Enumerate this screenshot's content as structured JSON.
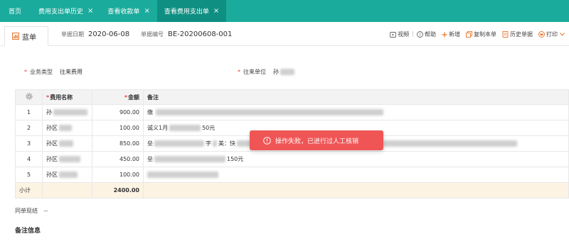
{
  "tabs": [
    {
      "label": "首页",
      "closable": false,
      "active": false
    },
    {
      "label": "费用支出单历史",
      "closable": true,
      "active": false
    },
    {
      "label": "查看收款单",
      "closable": true,
      "active": false
    },
    {
      "label": "查看费用支出单",
      "closable": true,
      "active": true
    }
  ],
  "doc": {
    "tab_label": "蓝单",
    "date_label": "单据日期",
    "date_value": "2020-06-08",
    "number_label": "单据编号",
    "number_value": "BE-20200608-001"
  },
  "toolbar": {
    "items": [
      {
        "label": "视频",
        "icon": "video-icon"
      },
      {
        "label": "帮助",
        "icon": "help-icon"
      },
      {
        "label": "新增",
        "icon": "plus-icon"
      },
      {
        "label": "复制本单",
        "icon": "copy-icon"
      },
      {
        "label": "历史单据",
        "icon": "history-icon"
      },
      {
        "label": "打印",
        "icon": "print-icon"
      }
    ],
    "separator": "|"
  },
  "form": {
    "biz_type_label": "业务类型",
    "biz_type_value": "往来费用",
    "unit_label": "往来单位",
    "unit_value": "孙"
  },
  "table": {
    "headers": {
      "settings": "settings-icon",
      "name": "费用名称",
      "amount": "金额",
      "remark": "备注"
    },
    "rows": [
      {
        "idx": "1",
        "name": "孙",
        "amount": "900.00",
        "remark": "缴"
      },
      {
        "idx": "2",
        "name": "孙区",
        "amount": "100.00",
        "remark": "诚义1月",
        "remark_tail": "50元"
      },
      {
        "idx": "3",
        "name": "孙区",
        "amount": "850.00",
        "remark": "垒",
        "remark_mid": "字",
        "remark_mid2": "美：快",
        "remark_tail": "工"
      },
      {
        "idx": "4",
        "name": "孙区",
        "amount": "450.00",
        "remark": "垒",
        "remark_tail": "150元"
      },
      {
        "idx": "5",
        "name": "孙区",
        "amount": "100.00",
        "remark": ""
      }
    ],
    "subtotal_label": "小计",
    "subtotal_amount": "2400.00"
  },
  "footer": {
    "same_unit_label": "同单现结",
    "same_unit_value": "--",
    "note_title": "备注信息"
  },
  "toast": {
    "message": "操作失败，已进行过人工核销",
    "icon": "alert-circle-icon"
  },
  "colors": {
    "topbar": "#1aab9c",
    "topbar_active": "#0f8f82",
    "required": "#e54545",
    "toast": "#f05555",
    "subtotal_bg": "#fdf3e3",
    "toolbar_accent": "#e8742a"
  }
}
